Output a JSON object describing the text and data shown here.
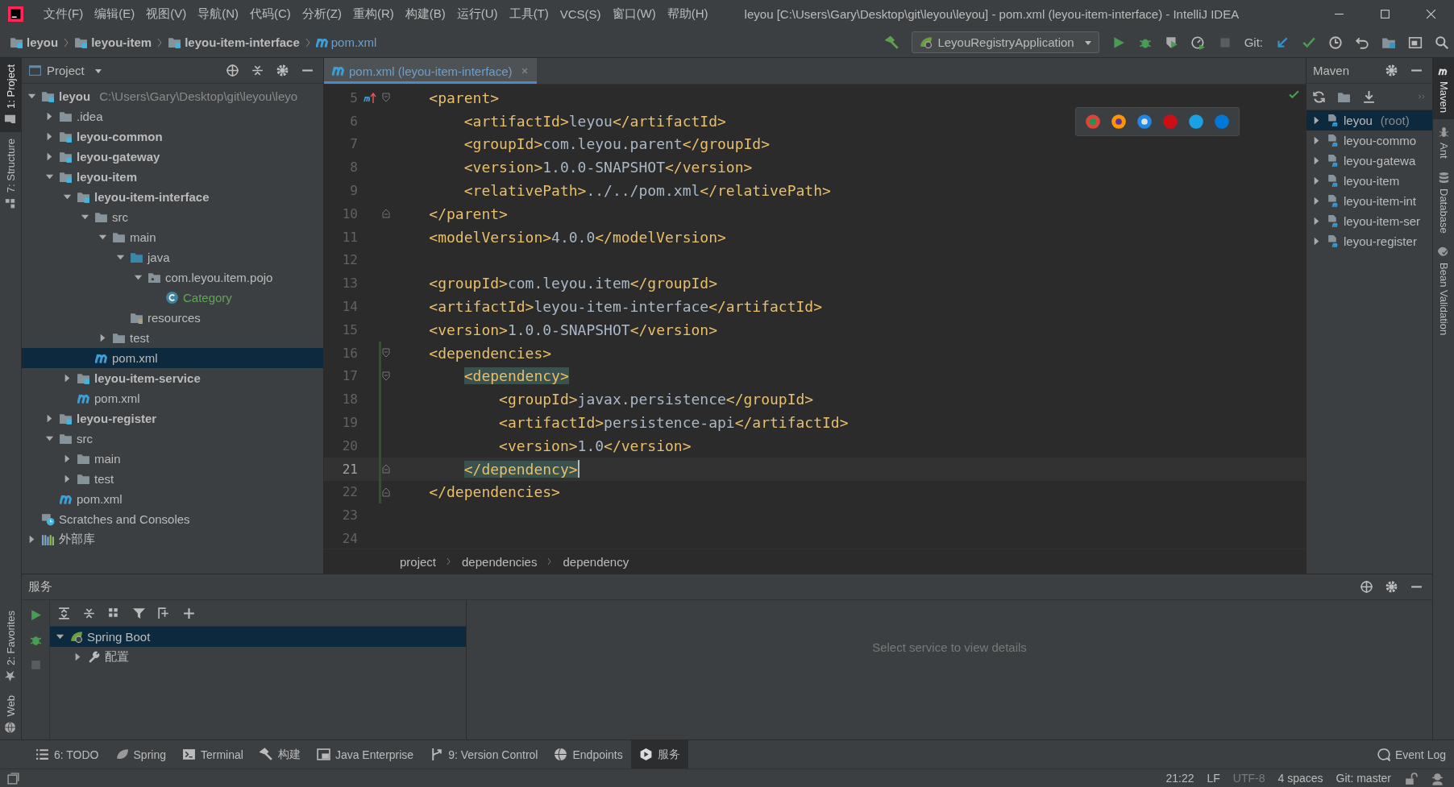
{
  "window": {
    "title": "leyou [C:\\Users\\Gary\\Desktop\\git\\leyou\\leyou] - pom.xml (leyou-item-interface) - IntelliJ IDEA"
  },
  "menu": [
    "文件(F)",
    "编辑(E)",
    "视图(V)",
    "导航(N)",
    "代码(C)",
    "分析(Z)",
    "重构(R)",
    "构建(B)",
    "运行(U)",
    "工具(T)",
    "VCS(S)",
    "窗口(W)",
    "帮助(H)"
  ],
  "nav_path": [
    {
      "label": "leyou",
      "kind": "module"
    },
    {
      "label": "leyou-item",
      "kind": "module"
    },
    {
      "label": "leyou-item-interface",
      "kind": "module"
    },
    {
      "label": "pom.xml",
      "kind": "pom"
    }
  ],
  "run_config": "LeyouRegistryApplication",
  "git_label": "Git:",
  "left_stripe": [
    {
      "label": "1: Project",
      "kind": "project",
      "selected": true
    },
    {
      "label": "7: Structure",
      "kind": "structure",
      "selected": false
    }
  ],
  "left_stripe_bottom": [
    {
      "label": "2: Favorites",
      "kind": "favorites",
      "selected": false
    },
    {
      "label": "Web",
      "kind": "web",
      "selected": false
    }
  ],
  "project": {
    "title": "Project",
    "tree": [
      {
        "label": "leyou",
        "note": "C:\\Users\\Gary\\Desktop\\git\\leyou\\leyo",
        "kind": "module",
        "selected": false,
        "expanded": true,
        "children": [
          {
            "label": ".idea",
            "kind": "folder",
            "selected": false,
            "expanded": false
          },
          {
            "label": "leyou-common",
            "kind": "module",
            "selected": false,
            "expanded": false
          },
          {
            "label": "leyou-gateway",
            "kind": "module",
            "selected": false,
            "expanded": false
          },
          {
            "label": "leyou-item",
            "kind": "module",
            "selected": false,
            "expanded": true,
            "children": [
              {
                "label": "leyou-item-interface",
                "kind": "module",
                "selected": false,
                "expanded": true,
                "children": [
                  {
                    "label": "src",
                    "kind": "folder",
                    "selected": false,
                    "expanded": true,
                    "children": [
                      {
                        "label": "main",
                        "kind": "folder",
                        "selected": false,
                        "expanded": true,
                        "children": [
                          {
                            "label": "java",
                            "kind": "source",
                            "selected": false,
                            "expanded": true,
                            "children": [
                              {
                                "label": "com.leyou.item.pojo",
                                "kind": "package",
                                "selected": false,
                                "expanded": true,
                                "children": [
                                  {
                                    "label": "Category",
                                    "kind": "class",
                                    "selected": false
                                  }
                                ]
                              }
                            ]
                          },
                          {
                            "label": "resources",
                            "kind": "resources",
                            "selected": false
                          }
                        ]
                      },
                      {
                        "label": "test",
                        "kind": "folder",
                        "selected": false,
                        "expanded": false
                      }
                    ]
                  },
                  {
                    "label": "pom.xml",
                    "kind": "pom",
                    "selected": true
                  }
                ]
              },
              {
                "label": "leyou-item-service",
                "kind": "module",
                "selected": false,
                "expanded": false
              },
              {
                "label": "pom.xml",
                "kind": "pom",
                "selected": false
              }
            ]
          },
          {
            "label": "leyou-register",
            "kind": "module",
            "selected": false,
            "expanded": false
          },
          {
            "label": "src",
            "kind": "folder",
            "selected": false,
            "expanded": true,
            "children": [
              {
                "label": "main",
                "kind": "folder",
                "selected": false,
                "expanded": false
              },
              {
                "label": "test",
                "kind": "folder",
                "selected": false,
                "expanded": false
              }
            ]
          },
          {
            "label": "pom.xml",
            "kind": "pom",
            "selected": false
          }
        ]
      },
      {
        "label": "Scratches and Consoles",
        "kind": "scratches",
        "selected": false
      },
      {
        "label": "外部库",
        "kind": "libraries",
        "selected": false,
        "expanded": false
      }
    ]
  },
  "editor": {
    "tabs": [
      {
        "label": "pom.xml (leyou-item-interface)",
        "selected": true
      }
    ],
    "lines": [
      {
        "number": "5",
        "current": false,
        "changed": false,
        "fold_start": true,
        "maven_marker": true,
        "tokens": [
          {
            "kind": "tag",
            "text": "    <parent>"
          }
        ]
      },
      {
        "number": "6",
        "current": false,
        "changed": false,
        "tokens": [
          {
            "kind": "tag",
            "text": "        <artifactId>"
          },
          {
            "kind": "text",
            "text": "leyou"
          },
          {
            "kind": "tag",
            "text": "</artifactId>"
          }
        ]
      },
      {
        "number": "7",
        "current": false,
        "changed": false,
        "tokens": [
          {
            "kind": "tag",
            "text": "        <groupId>"
          },
          {
            "kind": "text",
            "text": "com.leyou.parent"
          },
          {
            "kind": "tag",
            "text": "</groupId>"
          }
        ]
      },
      {
        "number": "8",
        "current": false,
        "changed": false,
        "tokens": [
          {
            "kind": "tag",
            "text": "        <version>"
          },
          {
            "kind": "text",
            "text": "1.0.0-SNAPSHOT"
          },
          {
            "kind": "tag",
            "text": "</version>"
          }
        ]
      },
      {
        "number": "9",
        "current": false,
        "changed": false,
        "tokens": [
          {
            "kind": "tag",
            "text": "        <relativePath>"
          },
          {
            "kind": "text",
            "text": "../../pom.xml"
          },
          {
            "kind": "tag",
            "text": "</relativePath>"
          }
        ]
      },
      {
        "number": "10",
        "current": false,
        "changed": false,
        "fold_end": true,
        "tokens": [
          {
            "kind": "tag",
            "text": "    </parent>"
          }
        ]
      },
      {
        "number": "11",
        "current": false,
        "changed": false,
        "tokens": [
          {
            "kind": "tag",
            "text": "    <modelVersion>"
          },
          {
            "kind": "text",
            "text": "4.0.0"
          },
          {
            "kind": "tag",
            "text": "</modelVersion>"
          }
        ]
      },
      {
        "number": "12",
        "current": false,
        "changed": false
      },
      {
        "number": "13",
        "current": false,
        "changed": false,
        "tokens": [
          {
            "kind": "tag",
            "text": "    <groupId>"
          },
          {
            "kind": "text",
            "text": "com.leyou.item"
          },
          {
            "kind": "tag",
            "text": "</groupId>"
          }
        ]
      },
      {
        "number": "14",
        "current": false,
        "changed": false,
        "tokens": [
          {
            "kind": "tag",
            "text": "    <artifactId>"
          },
          {
            "kind": "text",
            "text": "leyou-item-interface"
          },
          {
            "kind": "tag",
            "text": "</artifactId>"
          }
        ]
      },
      {
        "number": "15",
        "current": false,
        "changed": false,
        "tokens": [
          {
            "kind": "tag",
            "text": "    <version>"
          },
          {
            "kind": "text",
            "text": "1.0.0-SNAPSHOT"
          },
          {
            "kind": "tag",
            "text": "</version>"
          }
        ]
      },
      {
        "number": "16",
        "current": false,
        "changed": true,
        "fold_start": true,
        "tokens": [
          {
            "kind": "tag",
            "text": "    <dependencies>"
          }
        ]
      },
      {
        "number": "17",
        "current": false,
        "changed": true,
        "fold_start": true,
        "tokens": [
          {
            "kind": "tag",
            "text": "        <dependency>",
            "match": true
          }
        ]
      },
      {
        "number": "18",
        "current": false,
        "changed": true,
        "tokens": [
          {
            "kind": "tag",
            "text": "            <groupId>"
          },
          {
            "kind": "text",
            "text": "javax.persistence"
          },
          {
            "kind": "tag",
            "text": "</groupId>"
          }
        ]
      },
      {
        "number": "19",
        "current": false,
        "changed": true,
        "tokens": [
          {
            "kind": "tag",
            "text": "            <artifactId>"
          },
          {
            "kind": "text",
            "text": "persistence-api"
          },
          {
            "kind": "tag",
            "text": "</artifactId>"
          }
        ]
      },
      {
        "number": "20",
        "current": false,
        "changed": true,
        "tokens": [
          {
            "kind": "tag",
            "text": "            <version>"
          },
          {
            "kind": "text",
            "text": "1.0"
          },
          {
            "kind": "tag",
            "text": "</version>"
          }
        ]
      },
      {
        "number": "21",
        "current": true,
        "changed": true,
        "fold_end": true,
        "tokens": [
          {
            "kind": "tag",
            "text": "        </dependency>",
            "match": true
          }
        ]
      },
      {
        "number": "22",
        "current": false,
        "changed": true,
        "fold_end": true,
        "tokens": [
          {
            "kind": "tag",
            "text": "    </dependencies>"
          }
        ]
      },
      {
        "number": "23",
        "current": false,
        "changed": false
      },
      {
        "number": "24",
        "current": false,
        "changed": false
      }
    ],
    "breadcrumbs": [
      "project",
      "dependencies",
      "dependency"
    ]
  },
  "maven": {
    "title": "Maven",
    "items": [
      {
        "label": "leyou",
        "note": "(root)",
        "selected": true,
        "expanded": false
      },
      {
        "label": "leyou-commo",
        "selected": false,
        "expanded": false
      },
      {
        "label": "leyou-gatewa",
        "selected": false,
        "expanded": false
      },
      {
        "label": "leyou-item",
        "selected": false,
        "expanded": false
      },
      {
        "label": "leyou-item-int",
        "selected": false,
        "expanded": false
      },
      {
        "label": "leyou-item-ser",
        "selected": false,
        "expanded": false
      },
      {
        "label": "leyou-register",
        "selected": false,
        "expanded": false
      }
    ]
  },
  "right_stripe": [
    {
      "label": "Maven",
      "kind": "maven",
      "selected": true
    },
    {
      "label": "Ant",
      "kind": "ant",
      "selected": false
    },
    {
      "label": "Database",
      "kind": "database",
      "selected": false
    },
    {
      "label": "Bean Validation",
      "kind": "bean",
      "selected": false
    }
  ],
  "services": {
    "title": "服务",
    "tree": [
      {
        "label": "Spring Boot",
        "kind": "spring",
        "selected": true,
        "expanded": true,
        "children": [
          {
            "label": "配置",
            "kind": "config",
            "selected": false,
            "expanded": false
          }
        ]
      }
    ],
    "empty_text": "Select service to view details"
  },
  "tool_tabs": [
    {
      "label": "6: TODO",
      "kind": "todo",
      "selected": false
    },
    {
      "label": "Spring",
      "kind": "spring",
      "selected": false
    },
    {
      "label": "Terminal",
      "kind": "terminal",
      "selected": false
    },
    {
      "label": "构建",
      "kind": "build",
      "selected": false
    },
    {
      "label": "Java Enterprise",
      "kind": "enterprise",
      "selected": false
    },
    {
      "label": "9: Version Control",
      "kind": "vcs",
      "selected": false
    },
    {
      "label": "Endpoints",
      "kind": "endpoints",
      "selected": false
    },
    {
      "label": "服务",
      "kind": "services",
      "selected": true
    }
  ],
  "event_log": "Event Log",
  "status": {
    "position": "21:22",
    "line_sep": "LF",
    "encoding": "UTF-8",
    "indent": "4 spaces",
    "vcs": "Git: master"
  }
}
